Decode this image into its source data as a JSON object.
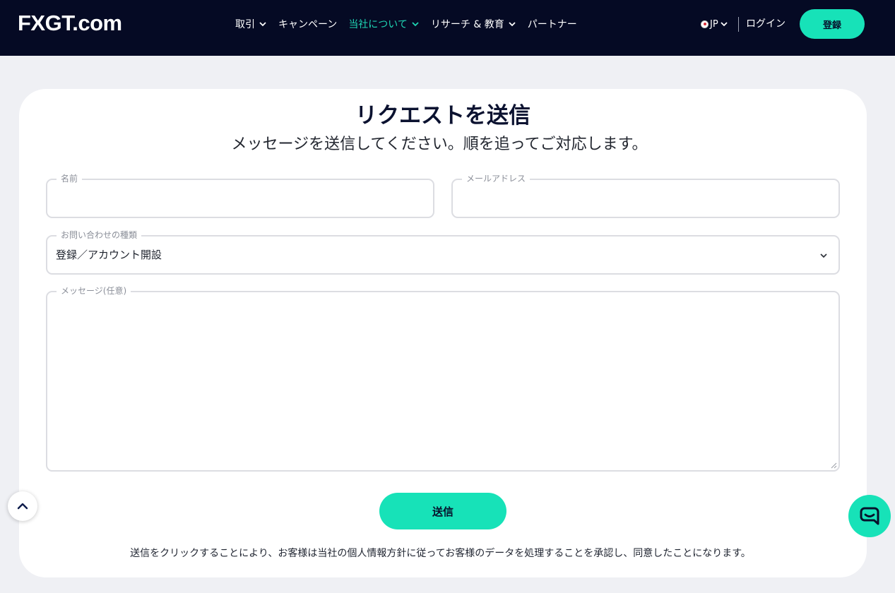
{
  "header": {
    "logo": "FXGT.com",
    "nav": [
      {
        "label": "取引",
        "has_dropdown": true,
        "active": false
      },
      {
        "label": "キャンペーン",
        "has_dropdown": false,
        "active": false
      },
      {
        "label": "当社について",
        "has_dropdown": true,
        "active": true
      },
      {
        "label": "リサーチ & 教育",
        "has_dropdown": true,
        "active": false
      },
      {
        "label": "パートナー",
        "has_dropdown": false,
        "active": false
      }
    ],
    "language": "JP",
    "login_label": "ログイン",
    "register_label": "登録"
  },
  "form": {
    "title": "リクエストを送信",
    "subtitle": "メッセージを送信してください。順を追ってご対応します。",
    "name_label": "名前",
    "name_value": "",
    "email_label": "メールアドレス",
    "email_value": "",
    "inquiry_type_label": "お問い合わせの種類",
    "inquiry_type_value": "登録／アカウント開設",
    "message_label": "メッセージ(任意)",
    "message_value": "",
    "submit_label": "送信",
    "footnote": "送信をクリックすることにより、お客様は当社の個人情報方針に従ってお客様のデータを処理することを承認し、同意したことになります。"
  },
  "colors": {
    "header_bg": "#050a24",
    "accent": "#17e2b8",
    "active_nav": "#1fd6b4",
    "page_bg": "#eff0f4"
  },
  "icons": {
    "scroll_top": "chevron-up-icon",
    "chat": "chat-bubble-icon",
    "select": "chevron-down-icon"
  }
}
